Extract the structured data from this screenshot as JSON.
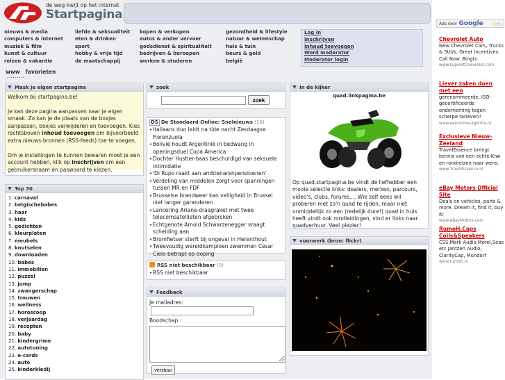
{
  "header": {
    "tagline": "de weg kwijt op het internet ?",
    "brand": "Startpagina.be"
  },
  "categories": {
    "col1": [
      "nieuws & media",
      "computers & internet",
      "muziek & film",
      "kunst & cultuur",
      "reizen & vakantie"
    ],
    "col2": [
      "liefde & seksualiteit",
      "eten & drinken",
      "sport",
      "hobby & vrije tijd",
      "de maatschappij"
    ],
    "col3": [
      "kopen & verkopen",
      "autos & ander vervoer",
      "godsdienst & spiritualiteit",
      "bedrijven & beroepen",
      "werken & studeren"
    ],
    "col4": [
      "gezondheid & lifestyle",
      "natuur & wetenschap",
      "huis & tuin",
      "beurs & geld",
      "belgië"
    ]
  },
  "login": [
    "Log in",
    "Inschrijven",
    "Inhoud toevoegen",
    "Word moderator",
    "Moderator login"
  ],
  "favorites": "www   favorieten",
  "mask": {
    "title": "Mask je eigen startpagina",
    "p1": "Welkom bij startpagina.be!",
    "p2a": "Je kan deze pagina aanpassen naar je eigen smaak. Zo kan je de plaats van de boxjes aanpassen, boxjes verwijderen en toevoegen. Kies rechtsboven ",
    "p2b": "inhoud toevoegen",
    "p2c": " om bijvoorbeeld extra nieuws-bronnen (RSS-feeds) toe te voegen.",
    "p3a": "Om je instellingen te kunnen bewaren moet je een account hebben, klik op ",
    "p3b": "inschrijven",
    "p3c": " om een gebruikersnaam en paswoord te kiezen."
  },
  "top30": {
    "title": "Top 30",
    "items": [
      "carnaval",
      "belgischebabes",
      "haar",
      "kids",
      "gedichten",
      "kleurplaten",
      "meubels",
      "knutselen",
      "downloaden",
      "babes",
      "immobilien",
      "puzzel",
      "jump",
      "zwangerschap",
      "trouwen",
      "wellness",
      "horoscoop",
      "verjaardag",
      "recepten",
      "baby",
      "kindergrime",
      "autotuning",
      "e-cards",
      "auto",
      "kinderkledij"
    ]
  },
  "zoek": {
    "title": "zoek",
    "input_value": "",
    "button": "zoek"
  },
  "news": {
    "icon": "DS",
    "title": "De Standaard Online: Snelnieuws",
    "count": "(10)",
    "items": [
      "Italiaans duo leidt na tide nacht Zesdaagse Fiorenzuola",
      "Bolivië houdt Argentinië in bedwang in openingsduel Copa America",
      "Dochter Hustler-baas beschuldigd van seksuele intimidatie",
      "'Di Rupo raakt aan ambtenarenpensioenen'",
      "Verdeling van middelen zorgt voor spanningen tussen MR en FDF",
      "Brusselse brandweer kan veiligheid in Brussel niet langer garanderen",
      "Lancering Ariane-draagraket met twee telecomsatellieten afgebroken",
      "Echtgenote Arnold Schwarzenegger vraagt scheiding aan",
      "Bromfietser sterft bij ongeval in Herenthout",
      "Tweevoudig wereldkampioen zwemmen Cesar Cielo betrapt op doping"
    ]
  },
  "rss": {
    "title": "RSS niet beschikbaar",
    "count": "(0)",
    "item": "RSS niet beschikbaar"
  },
  "feedback": {
    "title": "Feedback",
    "mail_label": "Je mailadres:",
    "msg_label": "Boodschap :",
    "button": "verstuur"
  },
  "kijker": {
    "title": "In de kijker",
    "subtitle": "quad.linkpagina.be",
    "text": "Op quad.startpagina.be vindt de liefhebber een mooie selectie links: dealers, merken, parcours, video's, clubs, forums,... Wie zelf eens wil proberen met zo'n quad te rijden, maar niet onmiddellijk zo een (redelijk dure!) quad in huis heeft vindt ook rondleidingen, vind er links naar quadverhuur. Veel plezier!"
  },
  "vuurwerk": {
    "title": "vuurwerk (bron: flickr)"
  },
  "ads": {
    "label": "Ads door",
    "google": "Google",
    "arrows": "◁ ▷",
    "items": [
      {
        "title": "Chevrolet Auto",
        "body": "New Chevrolet Cars, Trucks & SUVs. Great Incentives. Call Now. Bingtn.",
        "url": "www.LupientChevrolet.com"
      },
      {
        "title": "Liever zaken doen met een",
        "body": "gerenommeerde, ISO-gecertificeerde onderneming tegen scherpe tarieven?",
        "url": "www.eenonline-agentia.nl"
      },
      {
        "title": "Exclusieve Nieuw-Zeeland",
        "body": "TravelEssence brengt kennis van een echte Kiwi en rondreizen naar wens.",
        "url": "www.TravelEssence.nl"
      },
      {
        "title": "eBay Motors Official Site",
        "body": "Deals on vehicles, parts & more. Dream it, find it, buy it!",
        "url": "www.eBayMotors.com"
      },
      {
        "title": "RumoH,Caps Coils&Speakers",
        "body": "CSS,Mark Audio,Morel,Seas etc Jantzen Audio, ClarityCap, Mundorf",
        "url": "www.rumoh.nl"
      }
    ]
  }
}
